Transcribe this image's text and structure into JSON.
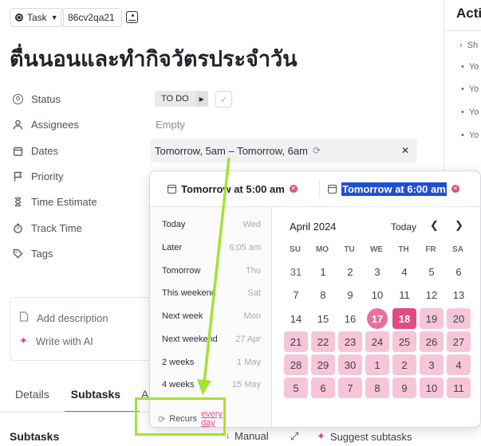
{
  "header": {
    "type_label": "Task",
    "task_id": "86cv2qa21"
  },
  "title": "ตื่นนอนและทำกิจวัตรประจำวัน",
  "fields": {
    "status_label": "Status",
    "status_value": "TO DO",
    "assignees_label": "Assignees",
    "assignees_value": "Empty",
    "dates_label": "Dates",
    "dates_value": "Tomorrow, 5am – Tomorrow, 6am",
    "priority_label": "Priority",
    "time_estimate_label": "Time Estimate",
    "track_time_label": "Track Time",
    "tags_label": "Tags"
  },
  "description": {
    "add_label": "Add description",
    "ai_label": "Write with AI"
  },
  "tabs": [
    "Details",
    "Subtasks",
    "Ac"
  ],
  "subtasks": {
    "title": "Subtasks",
    "manual_label": "Manual",
    "suggest_label": "Suggest subtasks"
  },
  "activity": {
    "title": "Acti",
    "items": [
      "Sh",
      "Yo",
      "Yo",
      "Yo",
      "Yo"
    ]
  },
  "popup": {
    "start_date": "Tomorrow at 5:00 am",
    "end_date": "Tomorrow at 6:00 am",
    "quick_options": [
      {
        "label": "Today",
        "hint": "Wed"
      },
      {
        "label": "Later",
        "hint": "6:05 am"
      },
      {
        "label": "Tomorrow",
        "hint": "Thu"
      },
      {
        "label": "This weekend",
        "hint": "Sat"
      },
      {
        "label": "Next week",
        "hint": "Mon"
      },
      {
        "label": "Next weekend",
        "hint": "27 Apr"
      },
      {
        "label": "2 weeks",
        "hint": "1 May"
      },
      {
        "label": "4 weeks",
        "hint": "15 May"
      }
    ],
    "recurs_label": "Recurs",
    "recurs_link_1": "every",
    "recurs_link_2": "day",
    "calendar": {
      "month": "April 2024",
      "today_label": "Today",
      "weekdays": [
        "SU",
        "MO",
        "TU",
        "WE",
        "TH",
        "FR",
        "SA"
      ],
      "weeks": [
        [
          "31",
          "1",
          "2",
          "3",
          "4",
          "5",
          "6"
        ],
        [
          "7",
          "8",
          "9",
          "10",
          "11",
          "12",
          "13"
        ],
        [
          "14",
          "15",
          "16",
          "17",
          "18",
          "19",
          "20"
        ],
        [
          "21",
          "22",
          "23",
          "24",
          "25",
          "26",
          "27"
        ],
        [
          "28",
          "29",
          "30",
          "1",
          "2",
          "3",
          "4"
        ],
        [
          "5",
          "6",
          "7",
          "8",
          "9",
          "10",
          "11"
        ]
      ],
      "today_day": "17",
      "selected_day": "18"
    }
  },
  "colors": {
    "accent": "#7b68ee",
    "pink": "#e34a82",
    "pink_range": "#f7c5d8",
    "annotation": "#a4e233"
  }
}
